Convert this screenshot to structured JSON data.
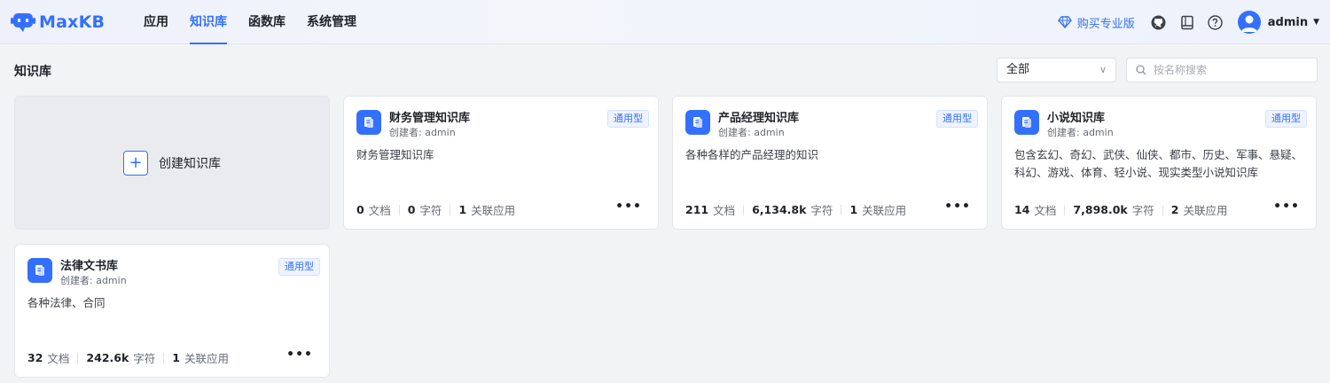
{
  "app": {
    "name": "MaxKB",
    "brand_color": "#3370ff"
  },
  "nav": {
    "items": [
      {
        "label": "应用",
        "active": false
      },
      {
        "label": "知识库",
        "active": true
      },
      {
        "label": "函数库",
        "active": false
      },
      {
        "label": "系统管理",
        "active": false
      }
    ]
  },
  "header": {
    "buy_pro_label": "购买专业版",
    "icons": [
      "github-icon",
      "document-icon",
      "help-icon"
    ],
    "user": {
      "name": "admin"
    }
  },
  "page": {
    "title": "知识库",
    "filter": {
      "selected": "全部"
    },
    "search": {
      "placeholder": "按名称搜索"
    },
    "create_label": "创建知识库"
  },
  "knowledge_bases": [
    {
      "name": "财务管理知识库",
      "creator": "创建者: admin",
      "tag": "通用型",
      "description": "财务管理知识库",
      "docs": "0",
      "docs_label": "文档",
      "chars": "0",
      "chars_label": "字符",
      "apps": "1",
      "apps_label": "关联应用"
    },
    {
      "name": "产品经理知识库",
      "creator": "创建者: admin",
      "tag": "通用型",
      "description": "各种各样的产品经理的知识",
      "docs": "211",
      "docs_label": "文档",
      "chars": "6,134.8k",
      "chars_label": "字符",
      "apps": "1",
      "apps_label": "关联应用"
    },
    {
      "name": "小说知识库",
      "creator": "创建者: admin",
      "tag": "通用型",
      "description": "包含玄幻、奇幻、武侠、仙侠、都市、历史、军事、悬疑、科幻、游戏、体育、轻小说、现实类型小说知识库",
      "docs": "14",
      "docs_label": "文档",
      "chars": "7,898.0k",
      "chars_label": "字符",
      "apps": "2",
      "apps_label": "关联应用"
    },
    {
      "name": "法律文书库",
      "creator": "创建者: admin",
      "tag": "通用型",
      "description": "各种法律、合同",
      "docs": "32",
      "docs_label": "文档",
      "chars": "242.6k",
      "chars_label": "字符",
      "apps": "1",
      "apps_label": "关联应用"
    }
  ]
}
